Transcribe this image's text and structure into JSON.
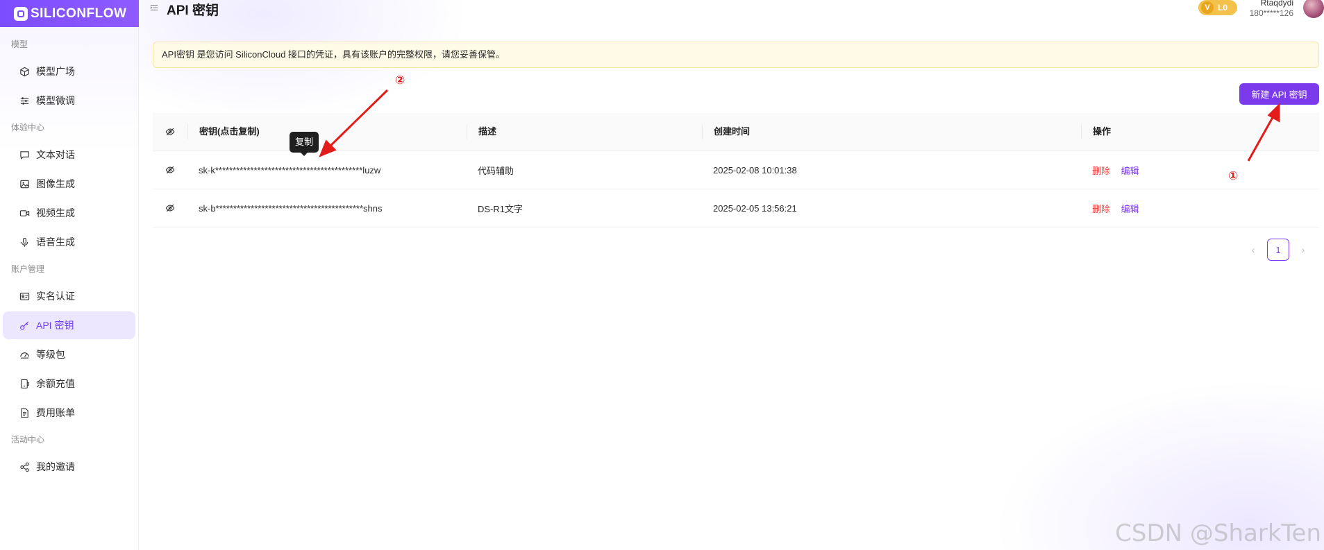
{
  "brand": {
    "name": "SILICONFLOW",
    "accent": "#7c3aed"
  },
  "sidebar": {
    "groups": [
      {
        "label": "模型",
        "items": [
          {
            "label": "模型广场",
            "icon": "cube-icon"
          },
          {
            "label": "模型微调",
            "icon": "sliders-icon"
          }
        ]
      },
      {
        "label": "体验中心",
        "items": [
          {
            "label": "文本对话",
            "icon": "chat-icon"
          },
          {
            "label": "图像生成",
            "icon": "image-icon"
          },
          {
            "label": "视频生成",
            "icon": "video-icon"
          },
          {
            "label": "语音生成",
            "icon": "mic-icon"
          }
        ]
      },
      {
        "label": "账户管理",
        "items": [
          {
            "label": "实名认证",
            "icon": "id-card-icon"
          },
          {
            "label": "API 密钥",
            "icon": "key-icon",
            "active": true
          },
          {
            "label": "等级包",
            "icon": "gauge-icon"
          },
          {
            "label": "余额充值",
            "icon": "wallet-icon"
          },
          {
            "label": "费用账单",
            "icon": "bill-icon"
          }
        ]
      },
      {
        "label": "活动中心",
        "items": [
          {
            "label": "我的邀请",
            "icon": "share-icon"
          }
        ]
      }
    ]
  },
  "header": {
    "title": "API 密钥",
    "level_badge": "L0",
    "level_prefix": "V",
    "user_name": "Rtaqdydi",
    "user_phone": "180*****126"
  },
  "notice": "API密钥 是您访问 SiliconCloud 接口的凭证，具有该账户的完整权限，请您妥善保管。",
  "new_key_button": "新建 API 密钥",
  "table": {
    "headers": {
      "key": "密钥(点击复制)",
      "desc": "描述",
      "time": "创建时间",
      "op": "操作"
    },
    "rows": [
      {
        "key": "sk-k******************************************luzw",
        "desc": "代码辅助",
        "time": "2025-02-08 10:01:38",
        "del": "删除",
        "edit": "编辑"
      },
      {
        "key": "sk-b******************************************shns",
        "desc": "DS-R1文字",
        "time": "2025-02-05 13:56:21",
        "del": "删除",
        "edit": "编辑"
      }
    ]
  },
  "tooltip": "复制",
  "pagination": {
    "current": "1"
  },
  "annotations": {
    "one": "①",
    "two": "②"
  },
  "watermark": "CSDN @SharkTen"
}
